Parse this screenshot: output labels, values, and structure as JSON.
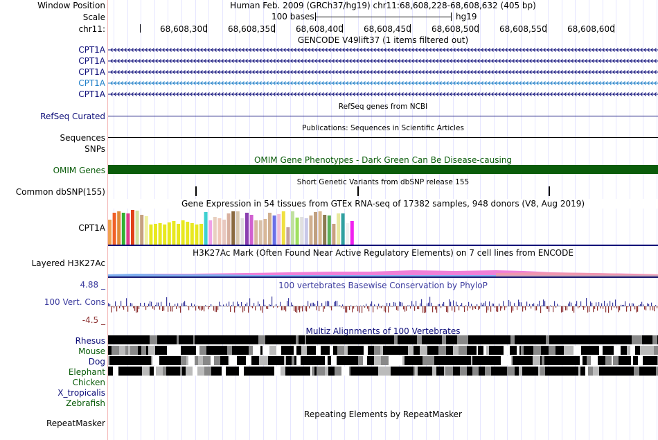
{
  "colors": {
    "navy": "#0c0c78",
    "transcript_blue": "#1f7fc8",
    "omim_green": "#0a5c0a",
    "conservation_blue": "#3b3b9e",
    "conservation_neg": "#8c2f2f",
    "side_divider": "#f4b8b8",
    "gridline": "#e6e6ff"
  },
  "header": {
    "window_position_label": "Window Position",
    "window_position_value": "Human Feb. 2009 (GRCh37/hg19)   chr11:68,608,228-68,608,632 (405 bp)",
    "scale_label": "Scale",
    "scale_value": "100 bases",
    "scale_assembly": "hg19",
    "chrom_label": "chr11:",
    "ruler_ticks": [
      "68,608,300",
      "68,608,350",
      "68,608,400",
      "68,608,450",
      "68,608,500",
      "68,608,550",
      "68,608,600"
    ]
  },
  "tracks": {
    "gencode": {
      "title": "GENCODE V49lift37 (1 items filtered out)",
      "items": [
        "CPT1A",
        "CPT1A",
        "CPT1A",
        "CPT1A",
        "CPT1A"
      ]
    },
    "refseq": {
      "label": "RefSeq Curated",
      "title": "RefSeq genes from NCBI"
    },
    "publications": {
      "label": "Sequences",
      "title": "Publications: Sequences in Scientific Articles"
    },
    "snps": {
      "label": "SNPs"
    },
    "omim": {
      "label": "OMIM Genes",
      "title": "OMIM Gene Phenotypes - Dark Green Can Be Disease-causing"
    },
    "dbsnp": {
      "label": "Common dbSNP(155)",
      "title": "Short Genetic Variants from dbSNP release 155"
    },
    "gtex": {
      "label": "CPT1A",
      "title": "Gene Expression in 54 tissues from GTEx RNA-seq of 17382 samples, 948 donors (V8, Aug 2019)",
      "bar_heights": [
        0.72,
        0.92,
        0.96,
        0.92,
        0.9,
        1.0,
        0.98,
        0.86,
        0.82,
        0.58,
        0.6,
        0.62,
        0.58,
        0.64,
        0.68,
        0.6,
        0.7,
        0.66,
        0.62,
        0.58,
        0.6,
        0.94,
        0.7,
        0.8,
        0.76,
        0.72,
        0.9,
        0.96,
        0.96,
        0.76,
        0.92,
        0.86,
        0.7,
        0.7,
        0.74,
        0.92,
        0.84,
        0.88,
        0.96,
        0.5,
        0.96,
        0.78,
        0.8,
        0.76,
        0.84,
        0.94,
        0.96,
        0.86,
        0.84,
        0.6,
        0.9,
        0.9,
        0.62,
        0.68
      ],
      "bar_colors": [
        "#f0a050",
        "#f06028",
        "#e08838",
        "#34b034",
        "#e03a8a",
        "#e04018",
        "#d2e0a0",
        "#c5a080",
        "#f0f0a0",
        "#e8e820",
        "#e8e820",
        "#e8e820",
        "#e8e820",
        "#e8e820",
        "#e8e820",
        "#e8e820",
        "#e8e820",
        "#e8e820",
        "#e8e820",
        "#e8e820",
        "#e8e820",
        "#40d0d0",
        "#f0a0e8",
        "#e8d0c0",
        "#f0c8b8",
        "#e8c8c0",
        "#d8b0a0",
        "#8a6a40",
        "#d8c8b0",
        "#e0e0e0",
        "#8a40b0",
        "#d060d0",
        "#d8b8a0",
        "#d8c0a8",
        "#d8b898",
        "#d0b090",
        "#6a70e8",
        "#f0c0d8",
        "#f0e040",
        "#c0a0a0",
        "#c0e0a0",
        "#a0e060",
        "#e0e0e0",
        "#c8c8e8",
        "#d0b090",
        "#c0a080",
        "#d8b890",
        "#8a7a50",
        "#5ab05a",
        "#c8a080",
        "#e8e8a0",
        "#30a0a0",
        "#f0f0f0",
        "#f020f0"
      ]
    },
    "h3k27ac": {
      "label": "Layered H3K27Ac",
      "title": "H3K27Ac Mark (Often Found Near Active Regulatory Elements) on 7 cell lines from ENCODE"
    },
    "conservation": {
      "label": "100 Vert. Cons",
      "title": "100 vertebrates Basewise Conservation by PhyloP",
      "ymax_label": "4.88 _",
      "ymin_label": "-4.5 _"
    },
    "multiz": {
      "title": "Multiz Alignments of 100 Vertebrates",
      "species": [
        {
          "name": "Rhesus",
          "color": "#0c0c78"
        },
        {
          "name": "Mouse",
          "color": "#0a5c0a"
        },
        {
          "name": "Dog",
          "color": "#0c0c78"
        },
        {
          "name": "Elephant",
          "color": "#0a5c0a"
        },
        {
          "name": "Chicken",
          "color": "#0a5c0a"
        },
        {
          "name": "X_tropicalis",
          "color": "#0c0c78"
        },
        {
          "name": "Zebrafish",
          "color": "#0a5c0a"
        }
      ]
    },
    "repeatmasker": {
      "label": "RepeatMasker",
      "title": "Repeating Elements by RepeatMasker"
    }
  }
}
